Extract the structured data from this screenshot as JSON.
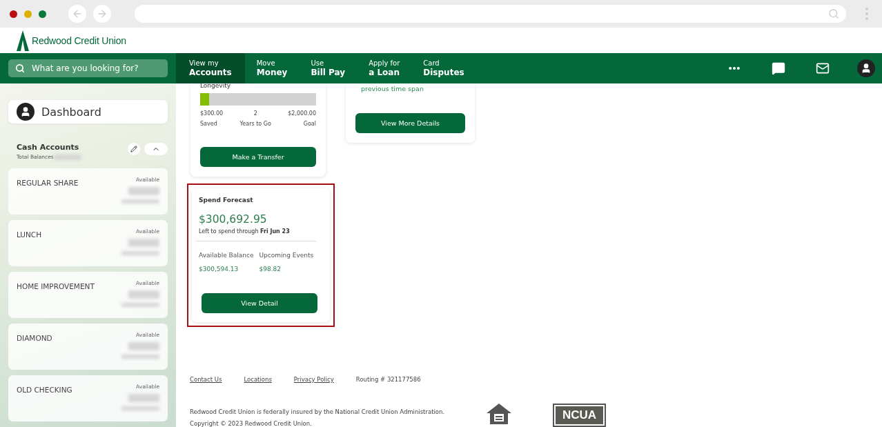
{
  "brand": {
    "name": "Redwood Credit Union"
  },
  "search": {
    "placeholder": "What are you looking for?"
  },
  "nav": [
    {
      "top": "View my",
      "bottom": "Accounts",
      "selected": true
    },
    {
      "top": "Move",
      "bottom": "Money",
      "selected": false
    },
    {
      "top": "Use",
      "bottom": "Bill Pay",
      "selected": false
    },
    {
      "top": "Apply for",
      "bottom": "a Loan",
      "selected": false
    },
    {
      "top": "Card",
      "bottom": "Disputes",
      "selected": false
    }
  ],
  "sidebar": {
    "title": "Dashboard",
    "section": {
      "title": "Cash Accounts",
      "subtitle": "Total Balances"
    },
    "accounts": [
      {
        "name": "REGULAR SHARE",
        "label": "Available"
      },
      {
        "name": "LUNCH",
        "label": "Available"
      },
      {
        "name": "HOME IMPROVEMENT",
        "label": "Available"
      },
      {
        "name": "DIAMOND",
        "label": "Available"
      },
      {
        "name": "OLD CHECKING",
        "label": "Available"
      }
    ]
  },
  "goal_card": {
    "title": "Longevity",
    "level": 0.075,
    "stats": [
      {
        "value": "$300.00",
        "label": "Saved"
      },
      {
        "value": "2",
        "label": "Years to Go"
      },
      {
        "value": "$2,000.00",
        "label": "Goal"
      }
    ],
    "button": "Make a Transfer"
  },
  "insight_card": {
    "text": "previous time span",
    "button": "View More Details"
  },
  "forecast_card": {
    "title": "Spend Forecast",
    "amount": "$300,692.95",
    "note": "Left to spend through **Fri Jun 23**",
    "highlighted": true,
    "stats": [
      {
        "label": "Available Balance",
        "value": "$300,594.13"
      },
      {
        "label": "Upcoming Events",
        "value": "$98.82"
      }
    ],
    "button": "View Detail"
  },
  "footer": {
    "links": [
      "Contact Us",
      "Locations",
      "Privacy Policy"
    ],
    "routing": "Routing # 321177586",
    "insurance": "Redwood Credit Union is federally insured by the National Credit Union Administration.",
    "copyright": "Copyright © 2023 Redwood Credit Union.",
    "badge": "NCUA"
  }
}
